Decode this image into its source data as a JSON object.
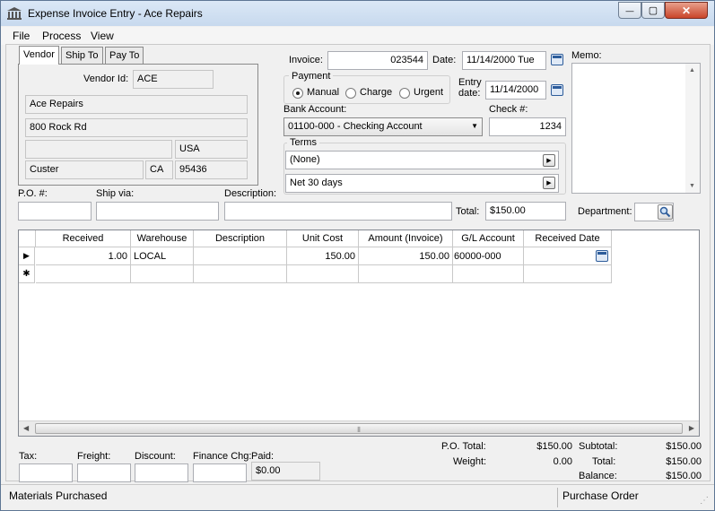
{
  "window": {
    "title": "Expense Invoice Entry - Ace Repairs",
    "minimize_glyph": "—",
    "maximize_glyph": "▢",
    "close_glyph": "✕"
  },
  "menu": [
    "File",
    "Process",
    "View"
  ],
  "tabs": [
    "Vendor",
    "Ship To",
    "Pay To"
  ],
  "vendor": {
    "vendor_id_label": "Vendor Id:",
    "vendor_id": "ACE",
    "name": "Ace Repairs",
    "address1": "800 Rock Rd",
    "address2": "",
    "country": "USA",
    "city": "Custer",
    "state": "CA",
    "zip": "95436"
  },
  "invoice": {
    "invoice_label": "Invoice:",
    "invoice": "023544",
    "date_label": "Date:",
    "date": "11/14/2000 Tue",
    "entry_date_label_1": "Entry",
    "entry_date_label_2": "date:",
    "entry_date": "11/14/2000",
    "bank_account_label": "Bank Account:",
    "bank_account": "01100-000 - Checking Account",
    "check_label": "Check #:",
    "check": "1234"
  },
  "payment": {
    "title": "Payment",
    "options": [
      "Manual",
      "Charge",
      "Urgent"
    ],
    "selected": "Manual"
  },
  "terms": {
    "title": "Terms",
    "value1": "(None)",
    "value2": "Net  30 days",
    "arrow_glyph": "▶"
  },
  "memo": {
    "label": "Memo:",
    "value": "",
    "scroll_up": "▲",
    "scroll_down": "▼"
  },
  "header_fields": {
    "po_label": "P.O. #:",
    "po": "",
    "ship_via_label": "Ship via:",
    "ship_via": "",
    "description_label": "Description:",
    "description": "",
    "total_label": "Total:",
    "total": "$150.00",
    "department_label": "Department:",
    "department": ""
  },
  "grid": {
    "columns": [
      "Received",
      "Warehouse",
      "Description",
      "Unit Cost",
      "Amount (Invoice)",
      "G/L Account",
      "Received Date"
    ],
    "rows": [
      {
        "received": "1.00",
        "warehouse": "LOCAL",
        "description": "",
        "unit_cost": "150.00",
        "amount": "150.00",
        "gl_account": "60000-000",
        "received_date": ""
      }
    ],
    "current_row_glyph": "▶",
    "new_row_glyph": "✱",
    "scroll_left": "◀",
    "scroll_right": "▶",
    "scroll_grip": "⦀"
  },
  "footer": {
    "tax_label": "Tax:",
    "tax": "",
    "freight_label": "Freight:",
    "freight": "",
    "discount_label": "Discount:",
    "discount": "",
    "finance_label": "Finance Chg:",
    "finance": "",
    "paid_label": "Paid:",
    "paid": "$0.00",
    "po_total_label": "P.O. Total:",
    "po_total": "$150.00",
    "weight_label": "Weight:",
    "weight": "0.00",
    "subtotal_label": "Subtotal:",
    "subtotal": "$150.00",
    "total_label": "Total:",
    "total": "$150.00",
    "balance_label": "Balance:",
    "balance": "$150.00"
  },
  "status": {
    "left": "Materials Purchased",
    "right": "Purchase Order"
  }
}
